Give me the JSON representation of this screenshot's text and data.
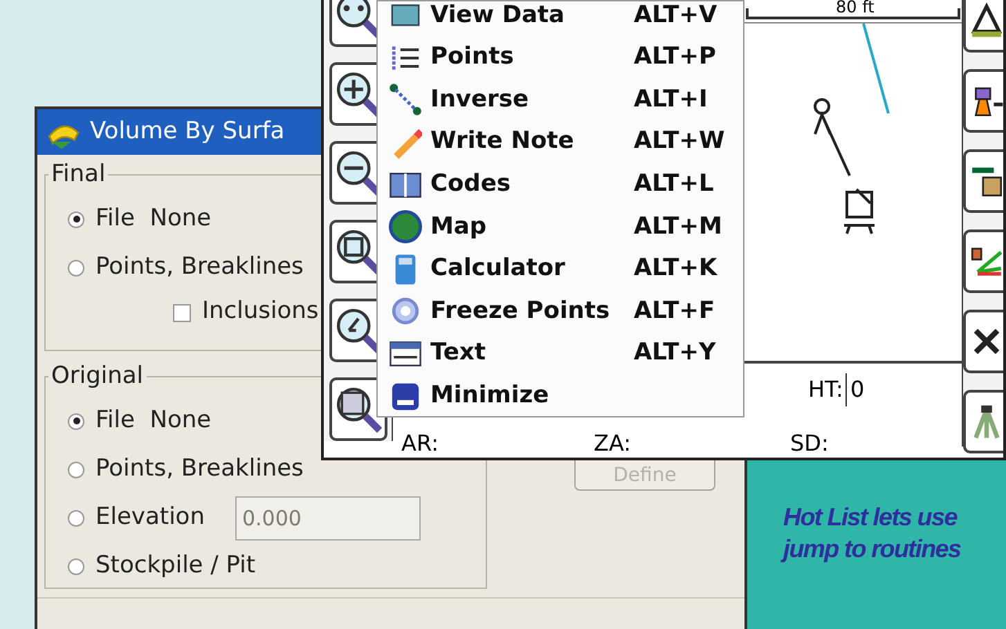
{
  "volume_dialog": {
    "title": "Volume By Surfa",
    "final": {
      "title": "Final",
      "options": [
        {
          "label": "File  None",
          "selected": true
        },
        {
          "label": "Points, Breaklines",
          "selected": false
        }
      ],
      "inclusions": {
        "label": "Inclusions",
        "checked": false
      }
    },
    "original": {
      "title": "Original",
      "options": [
        {
          "label": "File  None",
          "selected": true
        },
        {
          "label": "Points, Breaklines",
          "selected": false
        },
        {
          "label": "Elevation",
          "selected": false,
          "field_value": "0.000"
        },
        {
          "label": "Stockpile / Pit",
          "selected": false
        }
      ]
    },
    "define_button": {
      "label": "Define",
      "disabled": true
    }
  },
  "map_window": {
    "scale_label": "80 ft",
    "status": [
      {
        "label": "AR:"
      },
      {
        "label": "ZA:"
      },
      {
        "label": "HT:",
        "value": "0"
      },
      {
        "label": "SD:"
      }
    ]
  },
  "hot_list_menu": {
    "items": [
      {
        "label": "View Data",
        "shortcut": "ALT+V"
      },
      {
        "label": "Points",
        "shortcut": "ALT+P"
      },
      {
        "label": "Inverse",
        "shortcut": "ALT+I"
      },
      {
        "label": "Write Note",
        "shortcut": "ALT+W"
      },
      {
        "label": "Codes",
        "shortcut": "ALT+L"
      },
      {
        "label": "Map",
        "shortcut": "ALT+M"
      },
      {
        "label": "Calculator",
        "shortcut": "ALT+K"
      },
      {
        "label": "Freeze Points",
        "shortcut": "ALT+F"
      },
      {
        "label": "Text",
        "shortcut": "ALT+Y"
      },
      {
        "label": "Minimize"
      }
    ]
  },
  "caption": [
    "Hot List lets use",
    "jump to routines"
  ]
}
